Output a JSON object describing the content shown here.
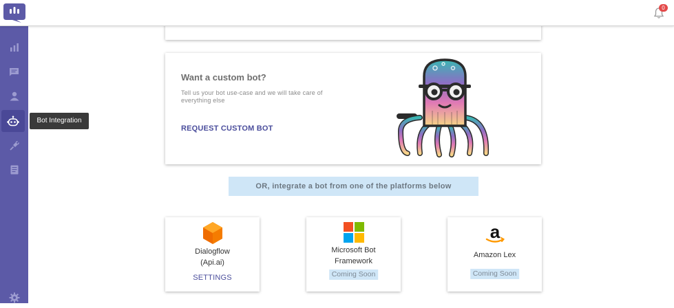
{
  "header": {
    "notification_count": "0"
  },
  "sidebar": {
    "items": [
      {
        "icon": "bar-chart-icon"
      },
      {
        "icon": "chat-icon"
      },
      {
        "icon": "users-icon"
      },
      {
        "icon": "bot-icon",
        "active": true
      },
      {
        "icon": "integration-icon"
      },
      {
        "icon": "document-icon"
      },
      {
        "icon": "gear-icon"
      }
    ],
    "tooltip": "Bot Integration"
  },
  "custom_bot": {
    "title": "Want a custom bot?",
    "description": "Tell us your bot use-case and we will take care of everything else",
    "link": "REQUEST CUSTOM BOT"
  },
  "or_banner": "OR, integrate a bot from one of the platforms below",
  "platforms": [
    {
      "name_line1": "Dialogflow",
      "name_line2": "(Api.ai)",
      "action": "SETTINGS",
      "icon": "dialogflow-logo"
    },
    {
      "name_line1": "Microsoft Bot",
      "name_line2": "Framework",
      "status": "Coming Soon",
      "icon": "microsoft-logo"
    },
    {
      "name_line1": "Amazon Lex",
      "status": "Coming Soon",
      "icon": "amazon-logo"
    }
  ],
  "colors": {
    "sidebar": "#5c5aa7",
    "accent": "#4b4e9c",
    "banner": "#cfe6f7",
    "badge": "#e34a4a"
  }
}
